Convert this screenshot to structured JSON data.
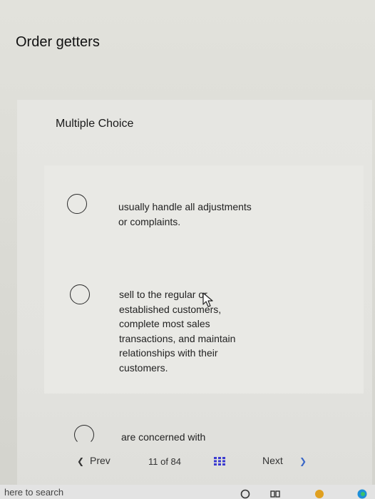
{
  "question": {
    "title": "Order getters",
    "type_label": "Multiple Choice"
  },
  "options": [
    {
      "text": "usually handle all adjustments\nor complaints."
    },
    {
      "text": "sell to the regular or\nestablished customers,\ncomplete most sales\ntransactions, and maintain\nrelationships with their\ncustomers."
    },
    {
      "text": "are concerned with"
    }
  ],
  "navigation": {
    "prev_label": "Prev",
    "prev_icon": "chevron-left-icon",
    "progress": "11 of 84",
    "grid_icon": "grid-icon",
    "next_label": "Next",
    "next_icon": "chevron-right-icon"
  },
  "taskbar": {
    "search_text": "here to search"
  },
  "colors": {
    "accent_blue": "#3a67c7"
  }
}
